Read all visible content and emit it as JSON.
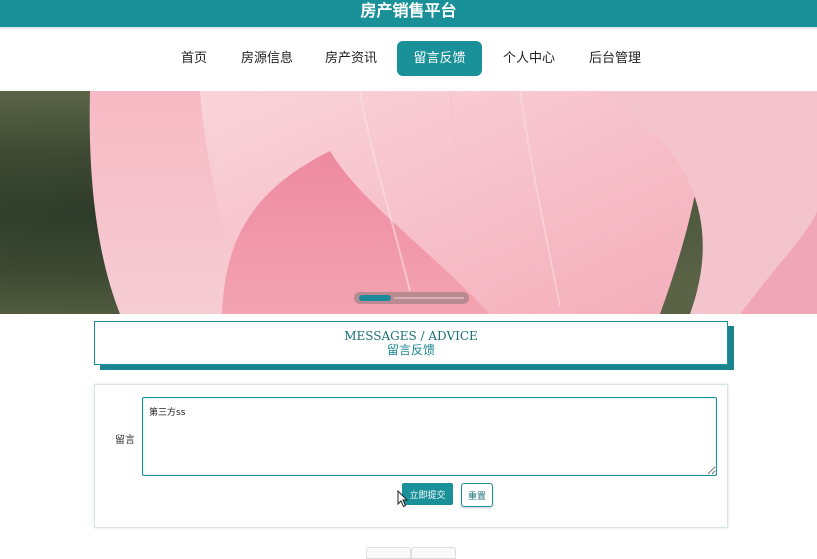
{
  "header": {
    "site_title": "房产销售平台"
  },
  "nav": {
    "items": [
      {
        "label": "首页"
      },
      {
        "label": "房源信息"
      },
      {
        "label": "房产资讯"
      },
      {
        "label": "留言反馈"
      },
      {
        "label": "个人中心"
      },
      {
        "label": "后台管理"
      }
    ],
    "active_index": 3
  },
  "banner": {
    "slider_progress": 0.3
  },
  "section": {
    "title_en": "MESSAGES / ADVICE",
    "title_zh": "留言反馈"
  },
  "form": {
    "message_label": "留言",
    "message_value": "第三方ss",
    "submit_label": "立即提交",
    "reset_label": "重置"
  },
  "colors": {
    "accent": "#1a9098",
    "shadow": "#1a8590"
  }
}
